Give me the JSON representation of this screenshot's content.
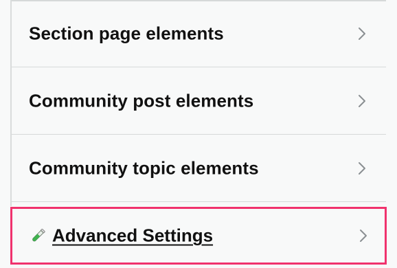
{
  "menu": {
    "items": [
      {
        "label": "Section page elements",
        "icon": "chevron-right-icon"
      },
      {
        "label": "Community post elements",
        "icon": "chevron-right-icon"
      },
      {
        "label": "Community topic elements",
        "icon": "chevron-right-icon"
      }
    ],
    "advanced": {
      "label": "Advanced Settings",
      "leading_icon": "test-tube-icon",
      "trailing_icon": "chevron-right-icon"
    }
  },
  "colors": {
    "background": "#f8f9f9",
    "divider": "#d6d9d9",
    "highlight_border": "#f0326d",
    "chevron": "#8a8f92",
    "text": "#111111"
  }
}
